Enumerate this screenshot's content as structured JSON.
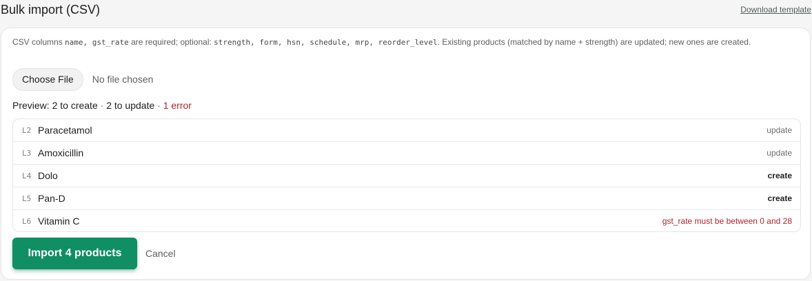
{
  "header": {
    "title": "Bulk import (CSV)",
    "download_label": "Download template"
  },
  "help": {
    "prefix": "CSV columns ",
    "required_cols": "name, gst_rate",
    "middle": " are required; optional: ",
    "optional_cols": "strength, form, hsn, schedule, mrp, reorder_level",
    "suffix": ". Existing products (matched by name + strength) are updated; new ones are created."
  },
  "file": {
    "choose_label": "Choose File",
    "status": "No file chosen"
  },
  "preview": {
    "label": "Preview:",
    "create_text": "2 to create",
    "separator": "·",
    "update_text": "2 to update",
    "error_text": "1 error"
  },
  "rows": [
    {
      "line": "L2",
      "name": "Paracetamol",
      "status": "update",
      "kind": "update"
    },
    {
      "line": "L3",
      "name": "Amoxicillin",
      "status": "update",
      "kind": "update"
    },
    {
      "line": "L4",
      "name": "Dolo",
      "status": "create",
      "kind": "create"
    },
    {
      "line": "L5",
      "name": "Pan-D",
      "status": "create",
      "kind": "create"
    },
    {
      "line": "L6",
      "name": "Vitamin C",
      "status": "gst_rate must be between 0 and 28",
      "kind": "error"
    }
  ],
  "actions": {
    "import_label": "Import 4 products",
    "cancel_label": "Cancel"
  },
  "colors": {
    "accent": "#0f8f63",
    "error": "#b4232a"
  }
}
